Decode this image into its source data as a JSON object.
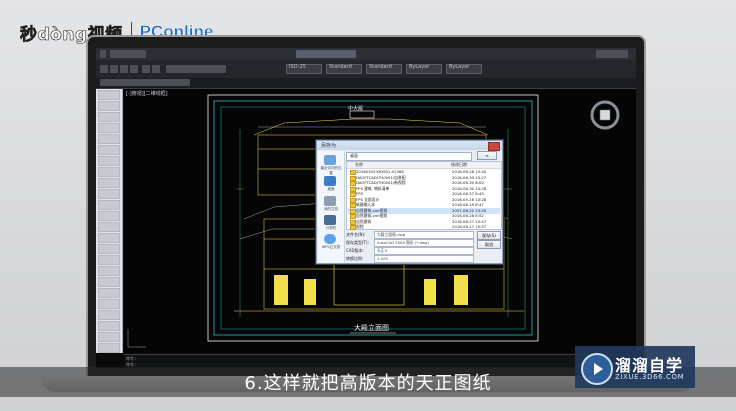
{
  "branding": {
    "logo_left": "秒dòng视频",
    "logo_right": "PConline"
  },
  "subtitle": "6.这样就把高版本的天正图纸",
  "watermark": {
    "title": "溜溜自学",
    "url": "ZIXUE.3D66.COM"
  },
  "cad": {
    "drawing_tab": "[-]俯视][二维线框]",
    "drawing_title": "大殿立面图",
    "top_label": "中大殿",
    "command_lines": [
      "命令:",
      "命令:"
    ],
    "toolbar_dropdowns": [
      "ISO-25",
      "Standard",
      "Standard",
      "ByLayer",
      "ByLayer"
    ]
  },
  "dialog": {
    "title": "另存为",
    "path": "桌面",
    "sidebar": [
      {
        "label": "最近访问的位置",
        "icon": "recent-icon"
      },
      {
        "label": "桌面",
        "icon": "desktop-icon"
      },
      {
        "label": "我的文档",
        "icon": "documents-icon"
      },
      {
        "label": "计算机",
        "icon": "computer-icon"
      },
      {
        "label": "WPS云文档",
        "icon": "cloud-icon"
      }
    ],
    "columns": {
      "name": "名称",
      "date": "修改日期"
    },
    "files": [
      {
        "name": "20160303 KIDS01-01368",
        "date": "2016-06-28 15:20",
        "selected": false
      },
      {
        "name": "DAOFTCAD/TH0001/自装配",
        "date": "2016-06-30 15:27",
        "selected": false
      },
      {
        "name": "DAOFTCAD/TH0001/新视频",
        "date": "2016-06-30 8:02",
        "selected": false
      },
      {
        "name": "FPS 建筑, 物料清单",
        "date": "2016-06-30 14:28",
        "selected": false
      },
      {
        "name": "FPS",
        "date": "2016-06-27 8:45",
        "selected": false
      },
      {
        "name": "FPS 全部设计",
        "date": "2016-05-16 10:28",
        "selected": false
      },
      {
        "name": "新建输入本",
        "date": "2016-06-29 8:47",
        "selected": false
      },
      {
        "name": "自然建筑.xml视频",
        "date": "2007-06-22 13:25",
        "selected": true
      },
      {
        "name": "自然建筑.xml视频",
        "date": "2016-06-28 8:52",
        "selected": false
      },
      {
        "name": "自然建筑",
        "date": "2016-06-27 10:57",
        "selected": false
      },
      {
        "name": "视频",
        "date": "2016-06-27 10:57",
        "selected": false
      }
    ],
    "fields": [
      {
        "label": "文件名(N):",
        "value": "大殿立面图.dwg"
      },
      {
        "label": "保存类型(T):",
        "value": "AutoCAD 2004 图形 (*.dwg)"
      },
      {
        "label": "CAD版本:",
        "value": "天正3"
      },
      {
        "label": "转换比例:",
        "value": "1:100"
      }
    ],
    "buttons": {
      "save": "保存(S)",
      "cancel": "取消"
    }
  }
}
